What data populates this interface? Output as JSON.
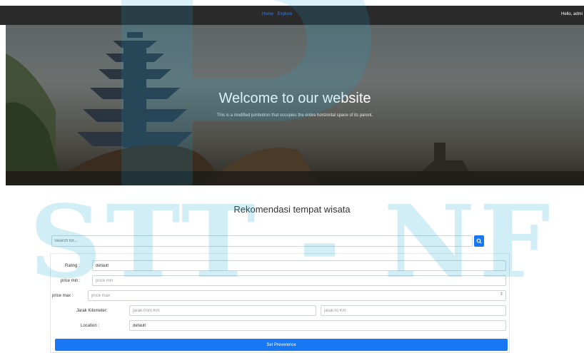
{
  "navbar": {
    "links": [
      {
        "label": "Home"
      },
      {
        "label": "Explore"
      }
    ],
    "greeting": "Hello, admi"
  },
  "hero": {
    "title": "Welcome to our website",
    "subtitle": "This is a modified jumbotron that occupies the entire horizontal space of its parent."
  },
  "section": {
    "title": "Rekomendasi tempat wisata"
  },
  "search": {
    "placeholder": "Search for...",
    "icon": "search-icon"
  },
  "form": {
    "rating": {
      "label": "Rating :",
      "value": "default"
    },
    "price_min": {
      "label": "price min :",
      "placeholder": "price min"
    },
    "price_max": {
      "label": "price max :",
      "placeholder": "price max"
    },
    "distance": {
      "label": "Jarak Kilometer:",
      "from_placeholder": "jarak-from Km",
      "to_placeholder": "jarak-to Km"
    },
    "location": {
      "label": "Location :",
      "value": "default"
    },
    "submit_label": "Set Preverence"
  },
  "watermark": {
    "text": "STT - NF"
  },
  "colors": {
    "accent": "#1877f2",
    "navbar": "#2b2b2b",
    "link": "#3b7bd8",
    "watermark": "#1aa8d8"
  }
}
